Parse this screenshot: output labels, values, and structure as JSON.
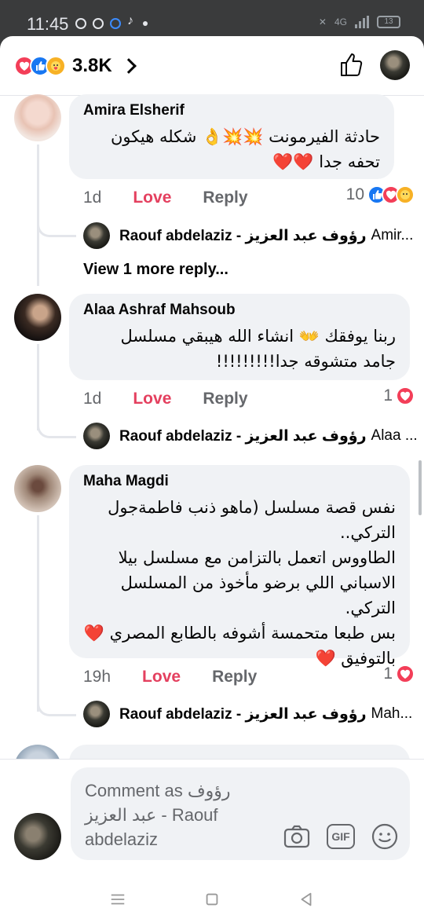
{
  "status_bar": {
    "time": "11:45",
    "network": "4G",
    "battery": "13"
  },
  "header": {
    "reaction_count": "3.8K",
    "icons": [
      "love-icon",
      "like-icon",
      "care-icon",
      "chevron-right-icon",
      "thumbs-up-icon"
    ]
  },
  "comments": [
    {
      "name": "Amira Elsherif",
      "text": "حادثة الفيرمونت 💥💥👌 شكله هيكون تحفه جدا ❤️❤️",
      "time": "1d",
      "love_label": "Love",
      "reply_label": "Reply",
      "reactions": "10",
      "reply": {
        "name": "Raouf abdelaziz - رؤوف عبد العزيز",
        "preview": "Amir..."
      },
      "view_more": "View 1 more reply..."
    },
    {
      "name": "Alaa Ashraf Mahsoub",
      "text": "ربنا يوفقك 👐 انشاء الله هيبقي مسلسل جامد متشوقه جدا!!!!!!!!!",
      "time": "1d",
      "love_label": "Love",
      "reply_label": "Reply",
      "reactions": "1",
      "reply": {
        "name": "Raouf abdelaziz - رؤوف عبد العزيز",
        "preview": "Alaa ..."
      }
    },
    {
      "name": "Maha Magdi",
      "text_lines": [
        "نفس قصة مسلسل (ماهو ذنب فاطمةجول",
        "التركي..",
        "الطاووس اتعمل بالتزامن مع مسلسل بيلا",
        "الاسباني اللي برضو مأخوذ من المسلسل التركي.",
        "بس طبعا متحمسة أشوفه بالطابع المصري ❤️",
        "بالتوفيق ❤️"
      ],
      "time": "19h",
      "love_label": "Love",
      "reply_label": "Reply",
      "reactions": "1",
      "reply": {
        "name": "Raouf abdelaziz - رؤوف عبد العزيز",
        "preview": "Mah..."
      }
    }
  ],
  "composer": {
    "placeholder_lines": [
      "Comment as رؤوف",
      "عبد العزيز - Raouf",
      "abdelaziz"
    ],
    "icons": [
      "camera-icon",
      "gif-icon",
      "emoji-icon"
    ]
  },
  "colors": {
    "love": "#e4405f",
    "like": "#1877f2",
    "bubble": "#f0f2f5",
    "secondary_text": "#65676b"
  }
}
